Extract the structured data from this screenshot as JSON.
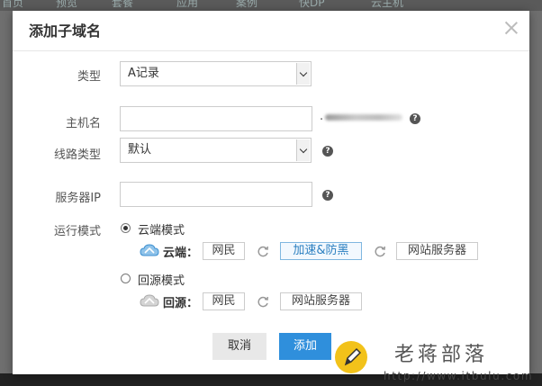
{
  "background_nav": [
    "首页",
    "预览",
    "套餐",
    "应用",
    "案例",
    "快DP",
    "云主机"
  ],
  "dialog": {
    "title": "添加子域名",
    "close_icon": "close-icon"
  },
  "form": {
    "type": {
      "label": "类型",
      "value": "A记录"
    },
    "host": {
      "label": "主机名",
      "value": "",
      "suffix_prefix": "."
    },
    "line": {
      "label": "线路类型",
      "value": "默认"
    },
    "server_ip": {
      "label": "服务器IP",
      "value": ""
    },
    "help_glyph": "?"
  },
  "run_mode": {
    "label": "运行模式",
    "cloud": {
      "option_label": "云端模式",
      "selected": true,
      "flow_label": "云端：",
      "chips": [
        "网民",
        "加速&防黑",
        "网站服务器"
      ],
      "active_chip": "加速&防黑"
    },
    "origin": {
      "option_label": "回源模式",
      "selected": false,
      "flow_label": "回源：",
      "chips": [
        "网民",
        "网站服务器"
      ]
    }
  },
  "buttons": {
    "cancel": "取消",
    "add": "添加"
  },
  "watermark": {
    "brand": "老蒋部落",
    "url": "http://www.itbulu.com"
  },
  "colors": {
    "primary": "#2f8fdc",
    "chip_active_border": "#7fb7e0",
    "chip_active_text": "#2b7fc0",
    "watermark_icon": "#f2c21a"
  }
}
